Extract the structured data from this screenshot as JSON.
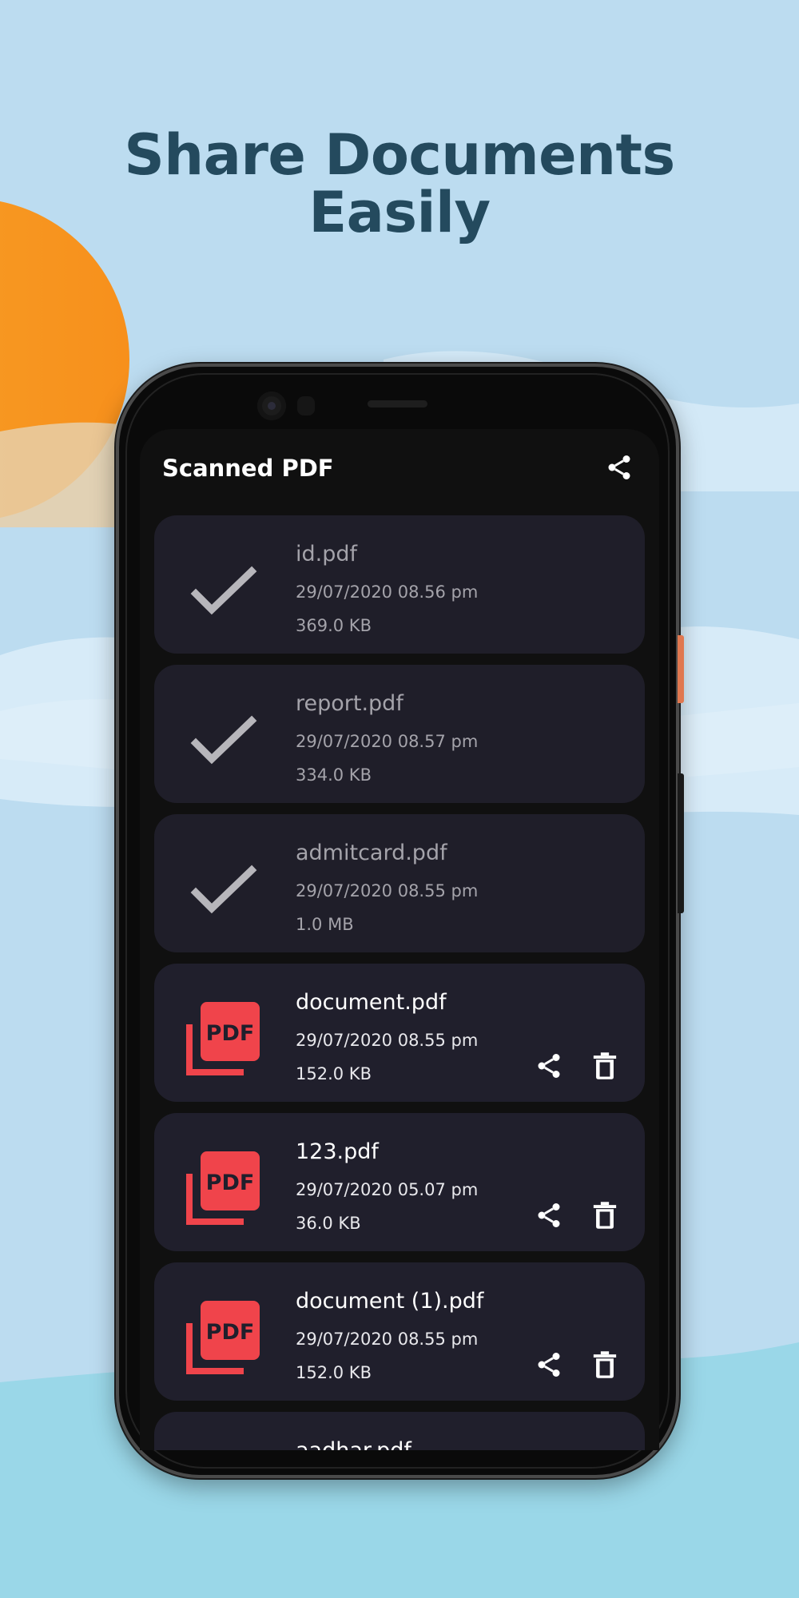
{
  "headline": {
    "line1": "Share Documents",
    "line2": "Easily"
  },
  "app": {
    "title": "Scanned PDF",
    "header_icon": "share-icon",
    "files": [
      {
        "name": "id.pdf",
        "date": "29/07/2020 08.56 pm",
        "size": "369.0 KB",
        "selected": true
      },
      {
        "name": "report.pdf",
        "date": "29/07/2020 08.57 pm",
        "size": "334.0 KB",
        "selected": true
      },
      {
        "name": "admitcard.pdf",
        "date": "29/07/2020 08.55 pm",
        "size": "1.0 MB",
        "selected": true
      },
      {
        "name": "document.pdf",
        "date": "29/07/2020 08.55 pm",
        "size": "152.0 KB",
        "selected": false
      },
      {
        "name": "123.pdf",
        "date": "29/07/2020 05.07 pm",
        "size": "36.0 KB",
        "selected": false
      },
      {
        "name": "document (1).pdf",
        "date": "29/07/2020 08.55 pm",
        "size": "152.0 KB",
        "selected": false
      },
      {
        "name": "aadhar.pdf",
        "date": "",
        "size": "",
        "selected": false
      }
    ],
    "pdf_icon_text": "PDF",
    "row_icons": [
      "check-icon",
      "pdf-file-icon",
      "share-icon",
      "delete-icon"
    ]
  },
  "colors": {
    "background_sky": "#bcdcf0",
    "sun": "#f7941d",
    "headline": "#244a5e",
    "card": "#201f2c",
    "pdf_red": "#f0444b",
    "check": "#b7b6bb"
  }
}
